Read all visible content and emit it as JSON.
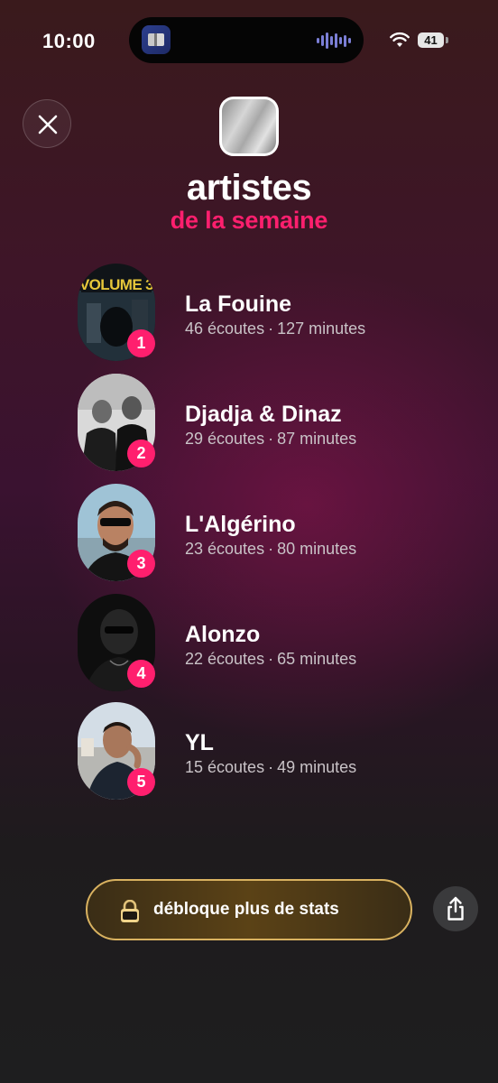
{
  "status_bar": {
    "time": "10:00",
    "battery": "41"
  },
  "header": {
    "title": "artistes",
    "subtitle": "de la semaine"
  },
  "artists": [
    {
      "rank": "1",
      "name": "La Fouine",
      "plays": "46 écoutes",
      "minutes": "127 minutes",
      "cover_text": "VOLUME 3"
    },
    {
      "rank": "2",
      "name": "Djadja & Dinaz",
      "plays": "29 écoutes",
      "minutes": "87 minutes"
    },
    {
      "rank": "3",
      "name": "L'Algérino",
      "plays": "23 écoutes",
      "minutes": "80 minutes"
    },
    {
      "rank": "4",
      "name": "Alonzo",
      "plays": "22 écoutes",
      "minutes": "65 minutes"
    },
    {
      "rank": "5",
      "name": "YL",
      "plays": "15 écoutes",
      "minutes": "49 minutes"
    }
  ],
  "separator": "·",
  "unlock_button": {
    "label": "débloque plus de stats"
  },
  "colors": {
    "accent": "#ff1f6e",
    "gold": "#d9b260"
  },
  "icons": [
    "close-icon",
    "wifi-icon",
    "battery-icon",
    "audio-wave-icon",
    "lock-icon",
    "share-icon"
  ]
}
